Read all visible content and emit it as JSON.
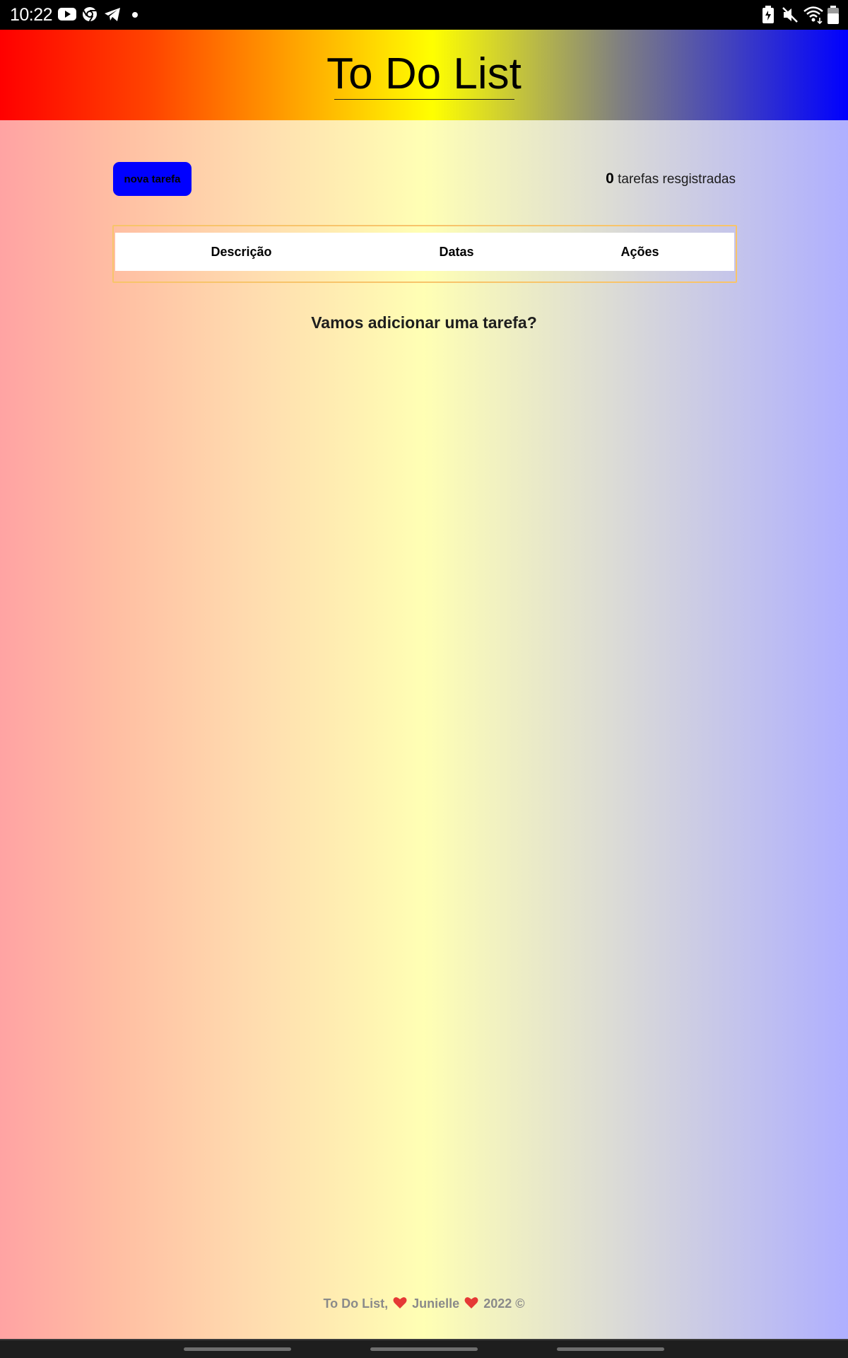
{
  "status_bar": {
    "time": "10:22",
    "left_icons": [
      "youtube-icon",
      "chrome-icon",
      "telegram-icon",
      "notification-dot-icon"
    ],
    "right_icons": [
      "battery-saver-icon",
      "mute-icon",
      "wifi-icon",
      "battery-icon"
    ]
  },
  "header": {
    "title": "To Do List"
  },
  "toolbar": {
    "new_task_label": "nova tarefa",
    "task_count": "0",
    "task_count_suffix": " tarefas resgistradas"
  },
  "table": {
    "columns": [
      "Descrição",
      "Datas",
      "Ações"
    ]
  },
  "empty_state": {
    "message": "Vamos adicionar uma tarefa?"
  },
  "footer": {
    "part1": "To Do List, ",
    "author": " Junielle ",
    "part3": " 2022 ©"
  },
  "colors": {
    "header_gradient": [
      "#ff0000",
      "#ff4500",
      "#ffa500",
      "#ffff00",
      "#808080",
      "#0000ff"
    ],
    "button": "#0000ff",
    "table_border": "#f8c46a",
    "heart": "#e53935"
  }
}
